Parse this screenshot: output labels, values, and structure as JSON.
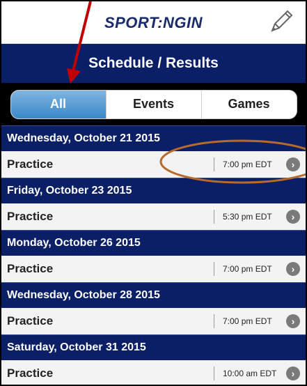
{
  "header": {
    "logo": "SPORT:NGIN",
    "pencil_icon": "pencil-icon"
  },
  "title": "Schedule / Results",
  "tabs": [
    {
      "label": "All",
      "active": true
    },
    {
      "label": "Events",
      "active": false
    },
    {
      "label": "Games",
      "active": false
    }
  ],
  "schedule": [
    {
      "date": "Wednesday, October 21 2015",
      "name": "Practice",
      "time": "7:00 pm EDT"
    },
    {
      "date": "Friday, October 23 2015",
      "name": "Practice",
      "time": "5:30 pm EDT"
    },
    {
      "date": "Monday, October 26 2015",
      "name": "Practice",
      "time": "7:00 pm EDT"
    },
    {
      "date": "Wednesday, October 28 2015",
      "name": "Practice",
      "time": "7:00 pm EDT"
    },
    {
      "date": "Saturday, October 31 2015",
      "name": "Practice",
      "time": "10:00 am EDT"
    }
  ],
  "colors": {
    "navy": "#0b1f66",
    "accent": "#3a88c9",
    "arrow": "#c00000",
    "circle": "#b86a2a"
  }
}
